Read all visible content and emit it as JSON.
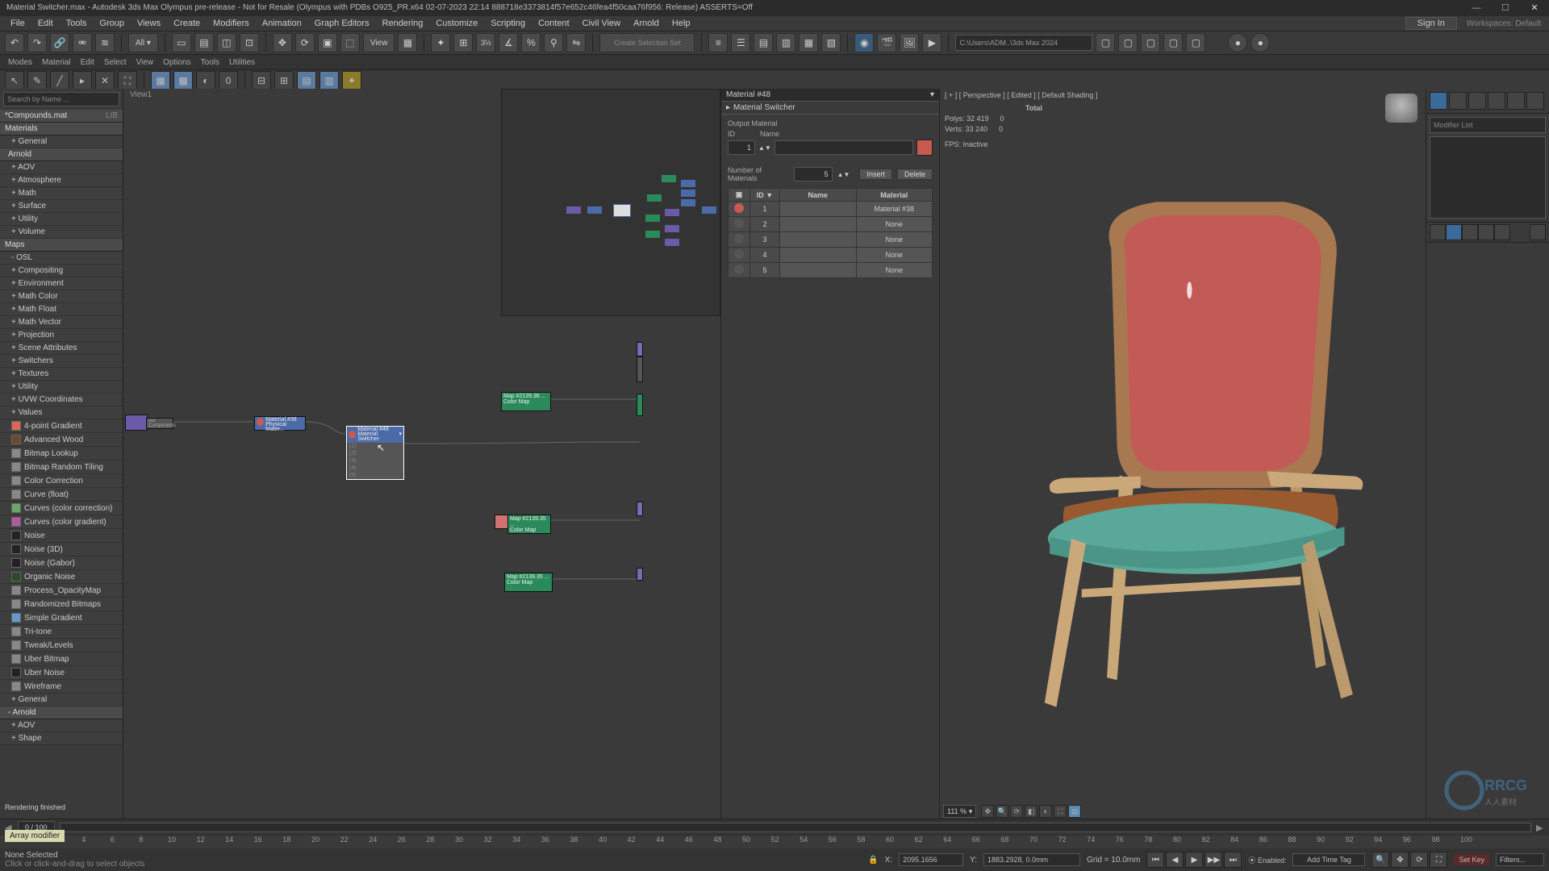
{
  "title": "Material Switcher.max - Autodesk 3ds Max Olympus pre-release - Not for Resale (Olympus with PDBs O925_PR.x64 02-07-2023 22:14 888718e3373814f57e652c46fea4f50caa76f956: Release) ASSERTS=Off",
  "menu": [
    "File",
    "Edit",
    "Tools",
    "Group",
    "Views",
    "Create",
    "Modifiers",
    "Animation",
    "Graph Editors",
    "Rendering",
    "Customize",
    "Scripting",
    "Content",
    "Civil View",
    "Arnold",
    "Help"
  ],
  "signin": "Sign In",
  "workspaces_label": "Workspaces: Default",
  "subbar": [
    "Modes",
    "Material",
    "Edit",
    "Select",
    "View",
    "Options",
    "Tools",
    "Utilities"
  ],
  "toolbar": {
    "view_label": "View",
    "selset": "Create Selection Set",
    "path": "C:\\Users\\ADM..\\3ds Max 2024"
  },
  "browser": {
    "search_placeholder": "Search by Name ...",
    "compounds_file": "*Compounds.mat",
    "lib_marker": "LIB",
    "groups": [
      {
        "name": "Materials",
        "items": [
          "+ General"
        ]
      },
      {
        "name": "Arnold",
        "items": [
          "+ AOV",
          "+ Atmosphere",
          "+ Math",
          "+ Surface",
          "+ Utility",
          "+ Volume"
        ]
      },
      {
        "name": "Maps",
        "items": [
          "- OSL",
          "+ Compositing",
          "+ Environment",
          "+ Math Color",
          "+ Math Float",
          "+ Math Vector",
          "+ Projection",
          "+ Scene Attributes",
          "+ Switchers",
          "+ Textures",
          "+ Utility",
          "+ UVW Coordinates",
          "+ Values"
        ]
      }
    ],
    "value_items": [
      {
        "label": "4-point Gradient",
        "color": "#dd6650"
      },
      {
        "label": "Advanced Wood",
        "color": "#6d4a2a"
      },
      {
        "label": "Bitmap Lookup",
        "color": "#888"
      },
      {
        "label": "Bitmap Random Tiling",
        "color": "#888"
      },
      {
        "label": "Color Correction",
        "color": "#888"
      },
      {
        "label": "Curve (float)",
        "color": "#888"
      },
      {
        "label": "Curves (color correction)",
        "color": "#6aa66a"
      },
      {
        "label": "Curves (color gradient)",
        "color": "#b05aa0"
      },
      {
        "label": "Noise",
        "color": "#222"
      },
      {
        "label": "Noise (3D)",
        "color": "#222"
      },
      {
        "label": "Noise (Gabor)",
        "color": "#222"
      },
      {
        "label": "Organic Noise",
        "color": "#2a4a2a"
      },
      {
        "label": "Process_OpacityMap",
        "color": "#888"
      },
      {
        "label": "Randomized Bitmaps",
        "color": "#888"
      },
      {
        "label": "Simple Gradient",
        "color": "#6699cc"
      },
      {
        "label": "Tri-tone",
        "color": "#888"
      },
      {
        "label": "Tweak/Levels",
        "color": "#888"
      },
      {
        "label": "Uber Bitmap",
        "color": "#888"
      },
      {
        "label": "Uber Noise",
        "color": "#222"
      },
      {
        "label": "Wireframe",
        "color": "#888"
      }
    ],
    "tail_items": [
      "+ General",
      "- Arnold",
      "+ AOV",
      "+ Shape"
    ]
  },
  "graph": {
    "view_title": "View1"
  },
  "params": {
    "header": "Material #48",
    "section": "Material Switcher",
    "output_label": "Output Material",
    "id_label": "ID",
    "name_label": "Name",
    "id_value": "1",
    "name_value": "",
    "swatch_color": "#c85a50",
    "num_label": "Number of Materials",
    "num_value": "5",
    "btn_insert": "Insert",
    "btn_delete": "Delete",
    "col_id": "ID ▼",
    "col_name": "Name",
    "col_mat": "Material",
    "rows": [
      {
        "thumb": "#c85a50",
        "id": "1",
        "name": "",
        "mat": "Material #38"
      },
      {
        "thumb": "#555",
        "id": "2",
        "name": "",
        "mat": "None"
      },
      {
        "thumb": "#555",
        "id": "3",
        "name": "",
        "mat": "None"
      },
      {
        "thumb": "#555",
        "id": "4",
        "name": "",
        "mat": "None"
      },
      {
        "thumb": "#555",
        "id": "5",
        "name": "",
        "mat": "None"
      }
    ]
  },
  "viewport": {
    "label": "[ + ] [ Perspective ] [ Edited ] [ Default Shading ]",
    "stat_total": "Total",
    "stat_polys": "Polys:  32 419",
    "stat_polys_r": "0",
    "stat_verts": "Verts:  33 240",
    "stat_verts_r": "0",
    "stat_fps": "FPS:    Inactive",
    "zoom": "111 %"
  },
  "rightpanel": {
    "modifier_label": "Modifier List"
  },
  "status": {
    "render_msg": "Rendering finished",
    "none_sel": "None Selected",
    "prompt": "Click or click-and-drag to select objects",
    "hoverchip": "Array modifier",
    "xlabel": "X:",
    "xval": "2095.1656",
    "ylabel": "Y:",
    "yval": "1883.2928, 0.0mm",
    "grid": "Grid = 10.0mm",
    "enabled": "Enabled:",
    "addtag": "Add Time Tag",
    "setkey": "Set Key",
    "filters": "Filters..."
  },
  "timeslider": {
    "current": "0 / 100"
  },
  "nodes": {
    "mat38": {
      "title": "Material #38",
      "sub": "Physical Mater..."
    },
    "switcher": {
      "title": "Material #48",
      "sub": "Material Switcher",
      "slots": [
        "(1)",
        "(2)",
        "(3)",
        "(4)",
        "(5)"
      ]
    },
    "map1": {
      "title": "Map #2139.36 ...",
      "sub": "Color Map"
    },
    "map2": {
      "title": "Map #2139.35 ...",
      "sub": "Color Map"
    },
    "map3": {
      "title": "Map #2139.35 ...",
      "sub": "Color Map"
    }
  }
}
